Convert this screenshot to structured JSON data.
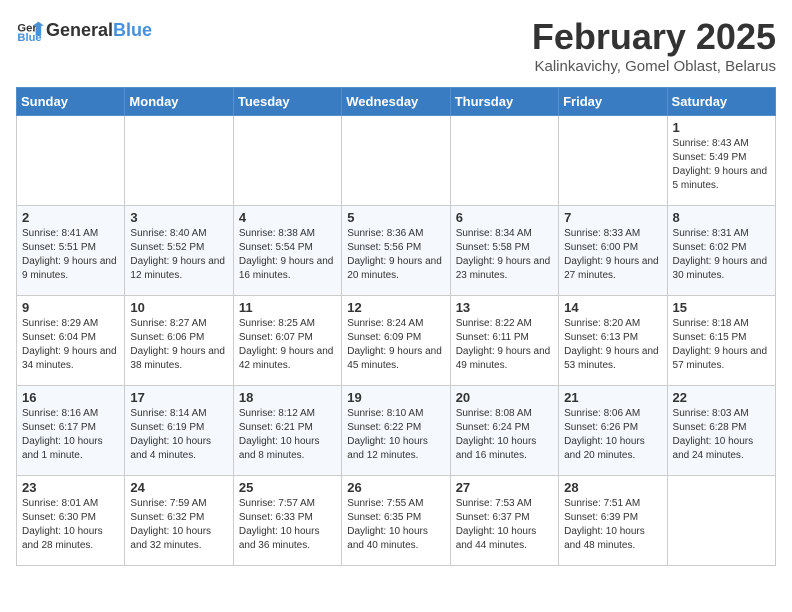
{
  "header": {
    "logo_general": "General",
    "logo_blue": "Blue",
    "title": "February 2025",
    "subtitle": "Kalinkavichy, Gomel Oblast, Belarus"
  },
  "weekdays": [
    "Sunday",
    "Monday",
    "Tuesday",
    "Wednesday",
    "Thursday",
    "Friday",
    "Saturday"
  ],
  "weeks": [
    [
      {
        "day": "",
        "info": ""
      },
      {
        "day": "",
        "info": ""
      },
      {
        "day": "",
        "info": ""
      },
      {
        "day": "",
        "info": ""
      },
      {
        "day": "",
        "info": ""
      },
      {
        "day": "",
        "info": ""
      },
      {
        "day": "1",
        "info": "Sunrise: 8:43 AM\nSunset: 5:49 PM\nDaylight: 9 hours and 5 minutes."
      }
    ],
    [
      {
        "day": "2",
        "info": "Sunrise: 8:41 AM\nSunset: 5:51 PM\nDaylight: 9 hours and 9 minutes."
      },
      {
        "day": "3",
        "info": "Sunrise: 8:40 AM\nSunset: 5:52 PM\nDaylight: 9 hours and 12 minutes."
      },
      {
        "day": "4",
        "info": "Sunrise: 8:38 AM\nSunset: 5:54 PM\nDaylight: 9 hours and 16 minutes."
      },
      {
        "day": "5",
        "info": "Sunrise: 8:36 AM\nSunset: 5:56 PM\nDaylight: 9 hours and 20 minutes."
      },
      {
        "day": "6",
        "info": "Sunrise: 8:34 AM\nSunset: 5:58 PM\nDaylight: 9 hours and 23 minutes."
      },
      {
        "day": "7",
        "info": "Sunrise: 8:33 AM\nSunset: 6:00 PM\nDaylight: 9 hours and 27 minutes."
      },
      {
        "day": "8",
        "info": "Sunrise: 8:31 AM\nSunset: 6:02 PM\nDaylight: 9 hours and 30 minutes."
      }
    ],
    [
      {
        "day": "9",
        "info": "Sunrise: 8:29 AM\nSunset: 6:04 PM\nDaylight: 9 hours and 34 minutes."
      },
      {
        "day": "10",
        "info": "Sunrise: 8:27 AM\nSunset: 6:06 PM\nDaylight: 9 hours and 38 minutes."
      },
      {
        "day": "11",
        "info": "Sunrise: 8:25 AM\nSunset: 6:07 PM\nDaylight: 9 hours and 42 minutes."
      },
      {
        "day": "12",
        "info": "Sunrise: 8:24 AM\nSunset: 6:09 PM\nDaylight: 9 hours and 45 minutes."
      },
      {
        "day": "13",
        "info": "Sunrise: 8:22 AM\nSunset: 6:11 PM\nDaylight: 9 hours and 49 minutes."
      },
      {
        "day": "14",
        "info": "Sunrise: 8:20 AM\nSunset: 6:13 PM\nDaylight: 9 hours and 53 minutes."
      },
      {
        "day": "15",
        "info": "Sunrise: 8:18 AM\nSunset: 6:15 PM\nDaylight: 9 hours and 57 minutes."
      }
    ],
    [
      {
        "day": "16",
        "info": "Sunrise: 8:16 AM\nSunset: 6:17 PM\nDaylight: 10 hours and 1 minute."
      },
      {
        "day": "17",
        "info": "Sunrise: 8:14 AM\nSunset: 6:19 PM\nDaylight: 10 hours and 4 minutes."
      },
      {
        "day": "18",
        "info": "Sunrise: 8:12 AM\nSunset: 6:21 PM\nDaylight: 10 hours and 8 minutes."
      },
      {
        "day": "19",
        "info": "Sunrise: 8:10 AM\nSunset: 6:22 PM\nDaylight: 10 hours and 12 minutes."
      },
      {
        "day": "20",
        "info": "Sunrise: 8:08 AM\nSunset: 6:24 PM\nDaylight: 10 hours and 16 minutes."
      },
      {
        "day": "21",
        "info": "Sunrise: 8:06 AM\nSunset: 6:26 PM\nDaylight: 10 hours and 20 minutes."
      },
      {
        "day": "22",
        "info": "Sunrise: 8:03 AM\nSunset: 6:28 PM\nDaylight: 10 hours and 24 minutes."
      }
    ],
    [
      {
        "day": "23",
        "info": "Sunrise: 8:01 AM\nSunset: 6:30 PM\nDaylight: 10 hours and 28 minutes."
      },
      {
        "day": "24",
        "info": "Sunrise: 7:59 AM\nSunset: 6:32 PM\nDaylight: 10 hours and 32 minutes."
      },
      {
        "day": "25",
        "info": "Sunrise: 7:57 AM\nSunset: 6:33 PM\nDaylight: 10 hours and 36 minutes."
      },
      {
        "day": "26",
        "info": "Sunrise: 7:55 AM\nSunset: 6:35 PM\nDaylight: 10 hours and 40 minutes."
      },
      {
        "day": "27",
        "info": "Sunrise: 7:53 AM\nSunset: 6:37 PM\nDaylight: 10 hours and 44 minutes."
      },
      {
        "day": "28",
        "info": "Sunrise: 7:51 AM\nSunset: 6:39 PM\nDaylight: 10 hours and 48 minutes."
      },
      {
        "day": "",
        "info": ""
      }
    ]
  ]
}
